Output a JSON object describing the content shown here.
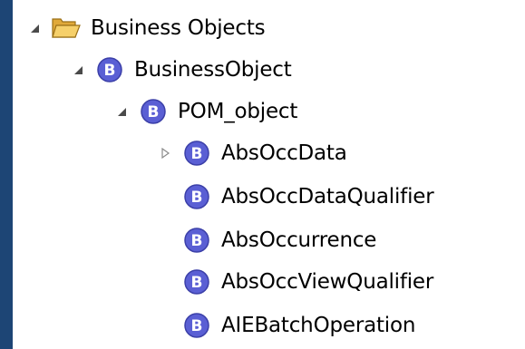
{
  "tree": {
    "root": {
      "label": "Business Objects",
      "icon": "open-folder-icon",
      "state": "expanded"
    },
    "items": [
      {
        "label": "BusinessObject",
        "icon": "business-object-icon",
        "state": "expanded"
      },
      {
        "label": "POM_object",
        "icon": "business-object-icon",
        "state": "expanded"
      },
      {
        "label": "AbsOccData",
        "icon": "business-object-icon",
        "state": "collapsed"
      },
      {
        "label": "AbsOccDataQualifier",
        "icon": "business-object-icon",
        "state": "leaf"
      },
      {
        "label": "AbsOccurrence",
        "icon": "business-object-icon",
        "state": "leaf"
      },
      {
        "label": "AbsOccViewQualifier",
        "icon": "business-object-icon",
        "state": "leaf"
      },
      {
        "label": "AIEBatchOperation",
        "icon": "business-object-icon",
        "state": "leaf"
      }
    ],
    "badge_letter": "B"
  },
  "colors": {
    "frame": "#1d4575",
    "panel": "#ffffff",
    "badge": "#5a5fd4",
    "folder": "#f0c24b"
  }
}
